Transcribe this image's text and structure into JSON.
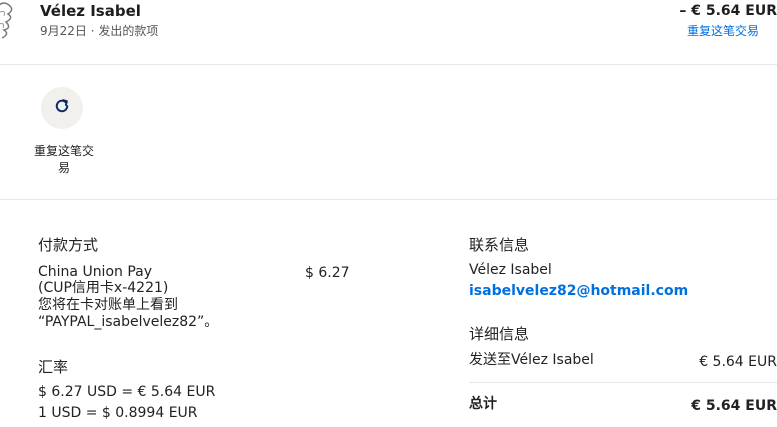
{
  "header": {
    "name": "Vélez Isabel",
    "subtitle": "9月22日 · 发出的款项",
    "amount": "– € 5.64 EUR",
    "repeat_link": "重复这笔交易"
  },
  "actions": {
    "repeat_label": "重复这笔交易"
  },
  "payment": {
    "title": "付款方式",
    "method_line1": "China Union Pay",
    "method_line2": "(CUP信用卡x-4221)",
    "method_line3": "您将在卡对账单上看到",
    "method_line4": "“PAYPAL_isabelvelez82”。",
    "amount": "$ 6.27"
  },
  "exchange": {
    "title": "汇率",
    "line1": "$ 6.27 USD = € 5.64 EUR",
    "line2": "1 USD = $ 0.8994 EUR"
  },
  "contact": {
    "title": "联系信息",
    "name": "Vélez Isabel",
    "email": "isabelvelez82@hotmail.com"
  },
  "details": {
    "title": "详细信息",
    "sent_to_label": "发送至Vélez Isabel",
    "sent_to_amount": "€ 5.64 EUR",
    "total_label": "总计",
    "total_amount": "€ 5.64 EUR"
  },
  "colors": {
    "link": "#0070e0",
    "button_bg": "#f1f0ec"
  },
  "icons": {
    "repeat": "refresh-icon"
  }
}
